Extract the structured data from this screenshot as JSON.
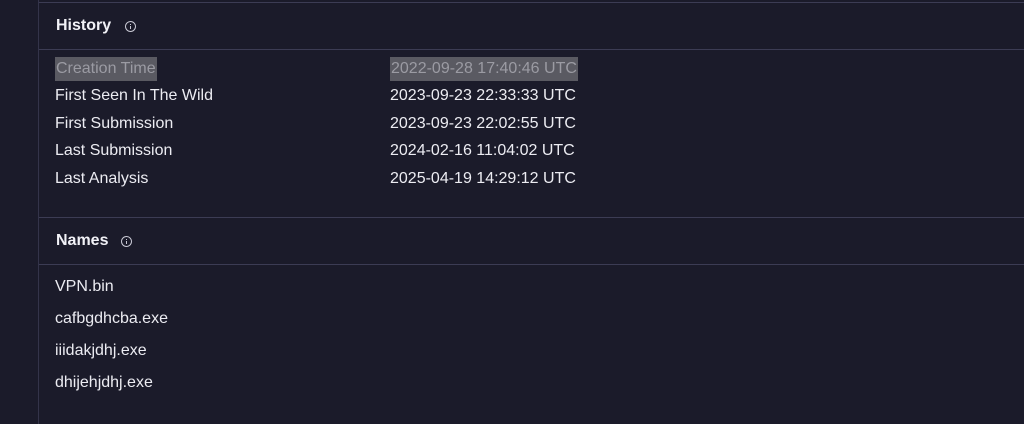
{
  "history": {
    "title": "History",
    "rows": [
      {
        "label": "Creation Time",
        "value": "2022-09-28 17:40:46 UTC"
      },
      {
        "label": "First Seen In The Wild",
        "value": "2023-09-23 22:33:33 UTC"
      },
      {
        "label": "First Submission",
        "value": "2023-09-23 22:02:55 UTC"
      },
      {
        "label": "Last Submission",
        "value": "2024-02-16 11:04:02 UTC"
      },
      {
        "label": "Last Analysis",
        "value": "2025-04-19 14:29:12 UTC"
      }
    ]
  },
  "names": {
    "title": "Names",
    "items": [
      "VPN.bin",
      "cafbgdhcba.exe",
      "iiidakjdhj.exe",
      "dhijehjdhj.exe"
    ]
  },
  "colors": {
    "background": "#1b1b2a",
    "divider": "#3c3c54",
    "text": "#ececf2",
    "selection_highlight": "#5a5a62"
  },
  "icons": {
    "history_info": "info-icon",
    "names_info": "info-icon"
  }
}
